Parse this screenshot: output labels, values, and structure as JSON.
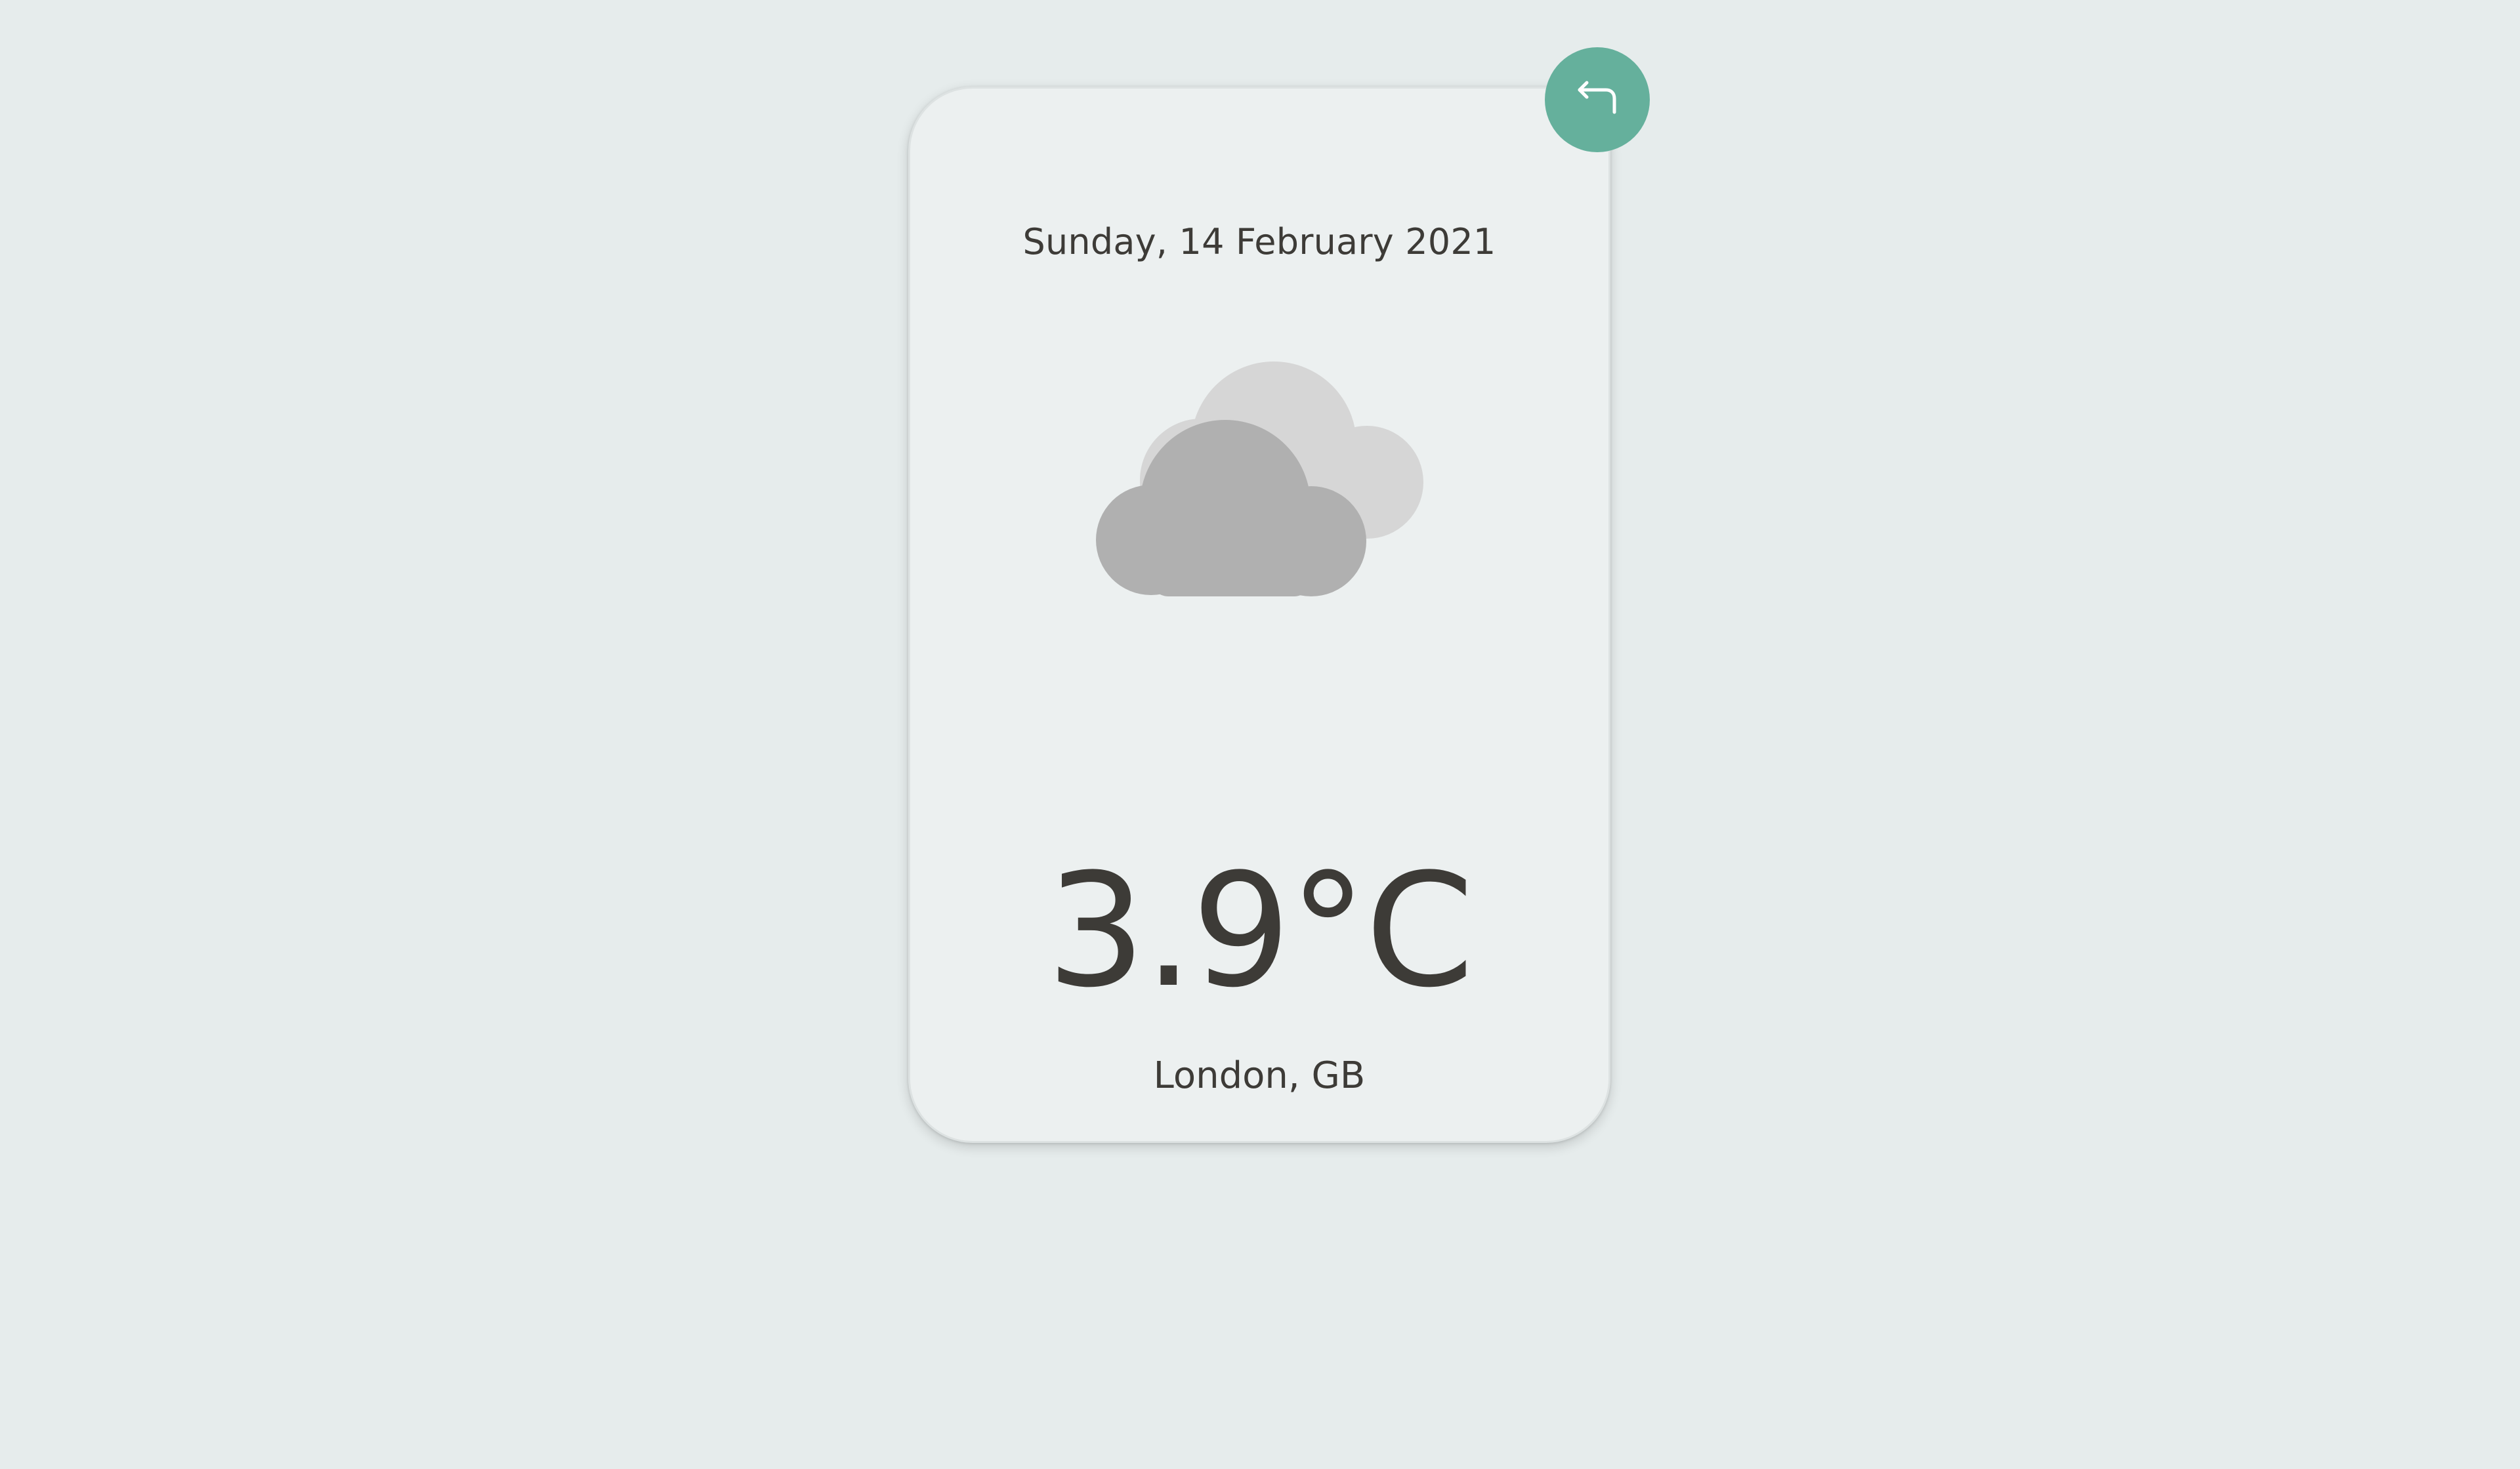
{
  "weather": {
    "date": "Sunday, 14 February 2021",
    "temperature": "3.9°C",
    "location": "London, GB",
    "condition_icon": "clouds-icon"
  },
  "controls": {
    "back_icon": "return-arrow-icon"
  },
  "colors": {
    "accent": "#65b09c",
    "background": "#e6ecec",
    "card": "#ecf0f0",
    "text": "#3d3b37",
    "cloud_front": "#b0b0b0",
    "cloud_back": "#d6d6d6"
  }
}
